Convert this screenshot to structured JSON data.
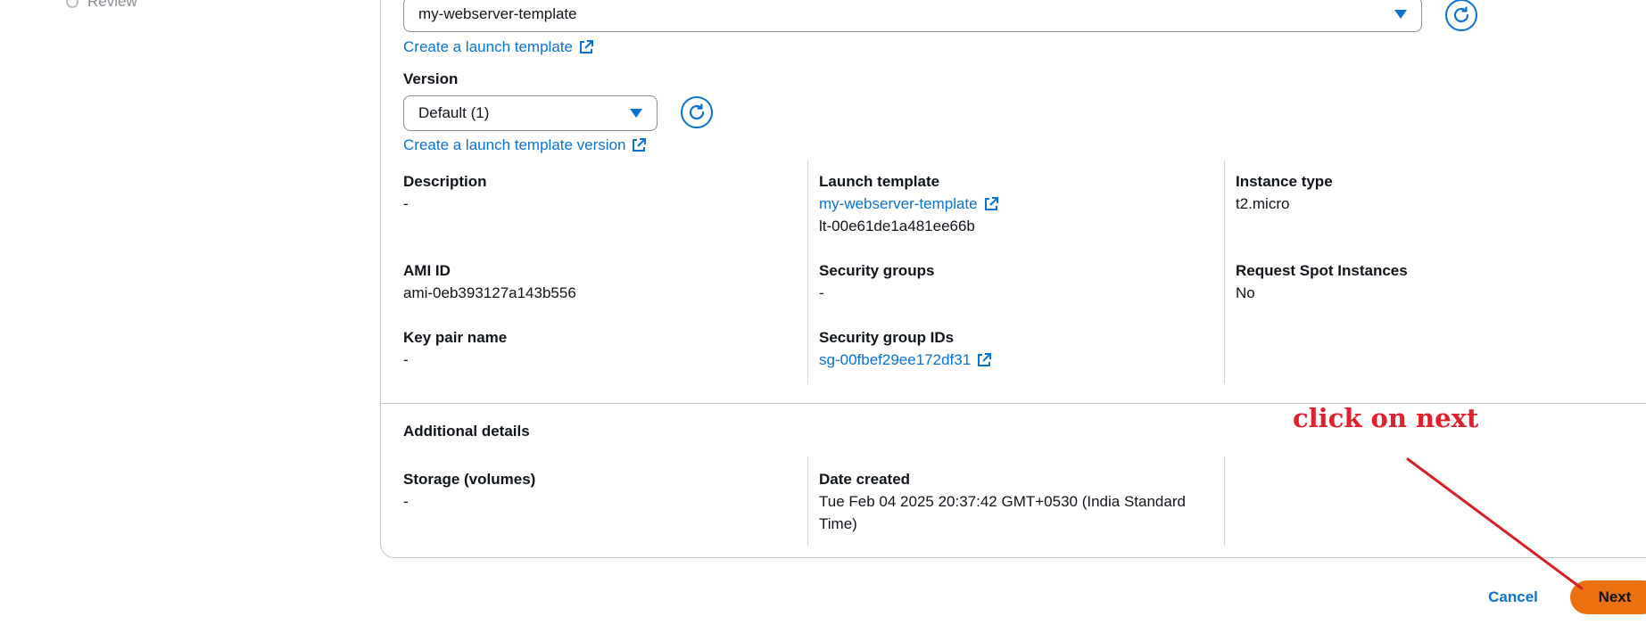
{
  "nav": {
    "review_step": "Review"
  },
  "launch_template": {
    "selected": "my-webserver-template",
    "create_link": "Create a launch template"
  },
  "version": {
    "label": "Version",
    "selected": "Default (1)",
    "create_link": "Create a launch template version"
  },
  "details": {
    "description_label": "Description",
    "description_value": "-",
    "ami_id_label": "AMI ID",
    "ami_id_value": "ami-0eb393127a143b556",
    "key_pair_label": "Key pair name",
    "key_pair_value": "-",
    "launch_template_label": "Launch template",
    "launch_template_link": "my-webserver-template",
    "launch_template_id": "lt-00e61de1a481ee66b",
    "security_groups_label": "Security groups",
    "security_groups_value": "-",
    "security_group_ids_label": "Security group IDs",
    "security_group_ids_link": "sg-00fbef29ee172df31",
    "instance_type_label": "Instance type",
    "instance_type_value": "t2.micro",
    "spot_label": "Request Spot Instances",
    "spot_value": "No"
  },
  "additional": {
    "heading": "Additional details",
    "storage_label": "Storage (volumes)",
    "storage_value": "-",
    "date_created_label": "Date created",
    "date_created_line1": "Tue Feb 04 2025 20:37:42 GMT+0530 (India Standard",
    "date_created_line2": "Time)"
  },
  "footer": {
    "cancel": "Cancel",
    "next": "Next"
  },
  "annotation": {
    "text": "click on next",
    "color": "#e0202a"
  },
  "colors": {
    "link": "#0972d3",
    "primary_button": "#ec7211"
  },
  "icons": [
    "refresh-icon",
    "external-link-icon",
    "caret-down-icon"
  ]
}
